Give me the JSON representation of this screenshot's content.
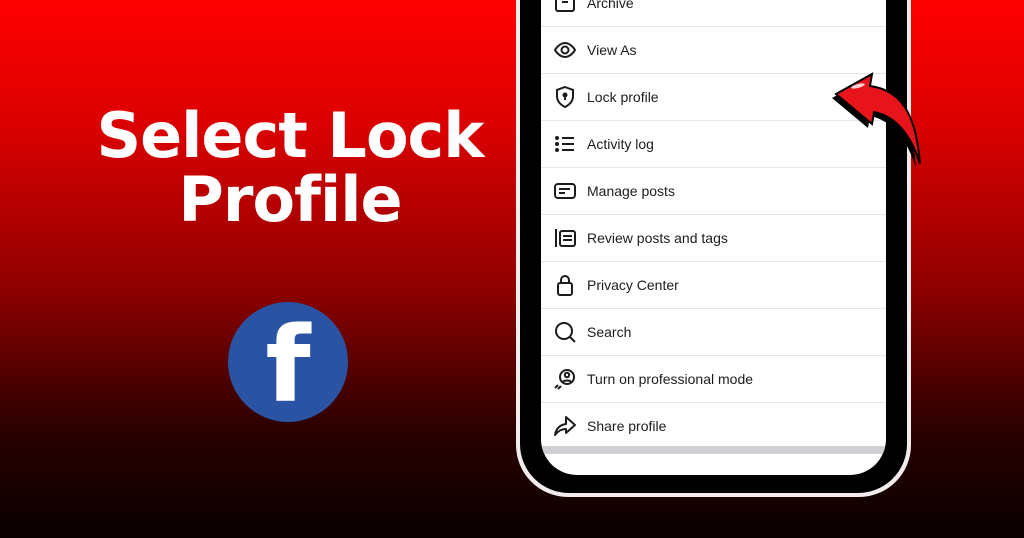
{
  "headline": {
    "line1": "Select Lock",
    "line2": "Profile"
  },
  "logo": {
    "letter": "f",
    "color": "#2a54a3"
  },
  "menu": {
    "items": [
      {
        "label": "Archive",
        "icon": "archive-icon"
      },
      {
        "label": "View As",
        "icon": "eye-icon"
      },
      {
        "label": "Lock profile",
        "icon": "shield-lock-icon"
      },
      {
        "label": "Activity log",
        "icon": "list-icon"
      },
      {
        "label": "Manage posts",
        "icon": "posts-icon"
      },
      {
        "label": "Review posts and tags",
        "icon": "tag-review-icon"
      },
      {
        "label": "Privacy Center",
        "icon": "lock-icon"
      },
      {
        "label": "Search",
        "icon": "search-icon"
      },
      {
        "label": "Turn on professional mode",
        "icon": "professional-icon"
      },
      {
        "label": "Share profile",
        "icon": "share-icon"
      }
    ]
  },
  "colors": {
    "arrow": "#e8141c",
    "background_top": "#ff0000",
    "background_bottom": "#0a0000"
  }
}
